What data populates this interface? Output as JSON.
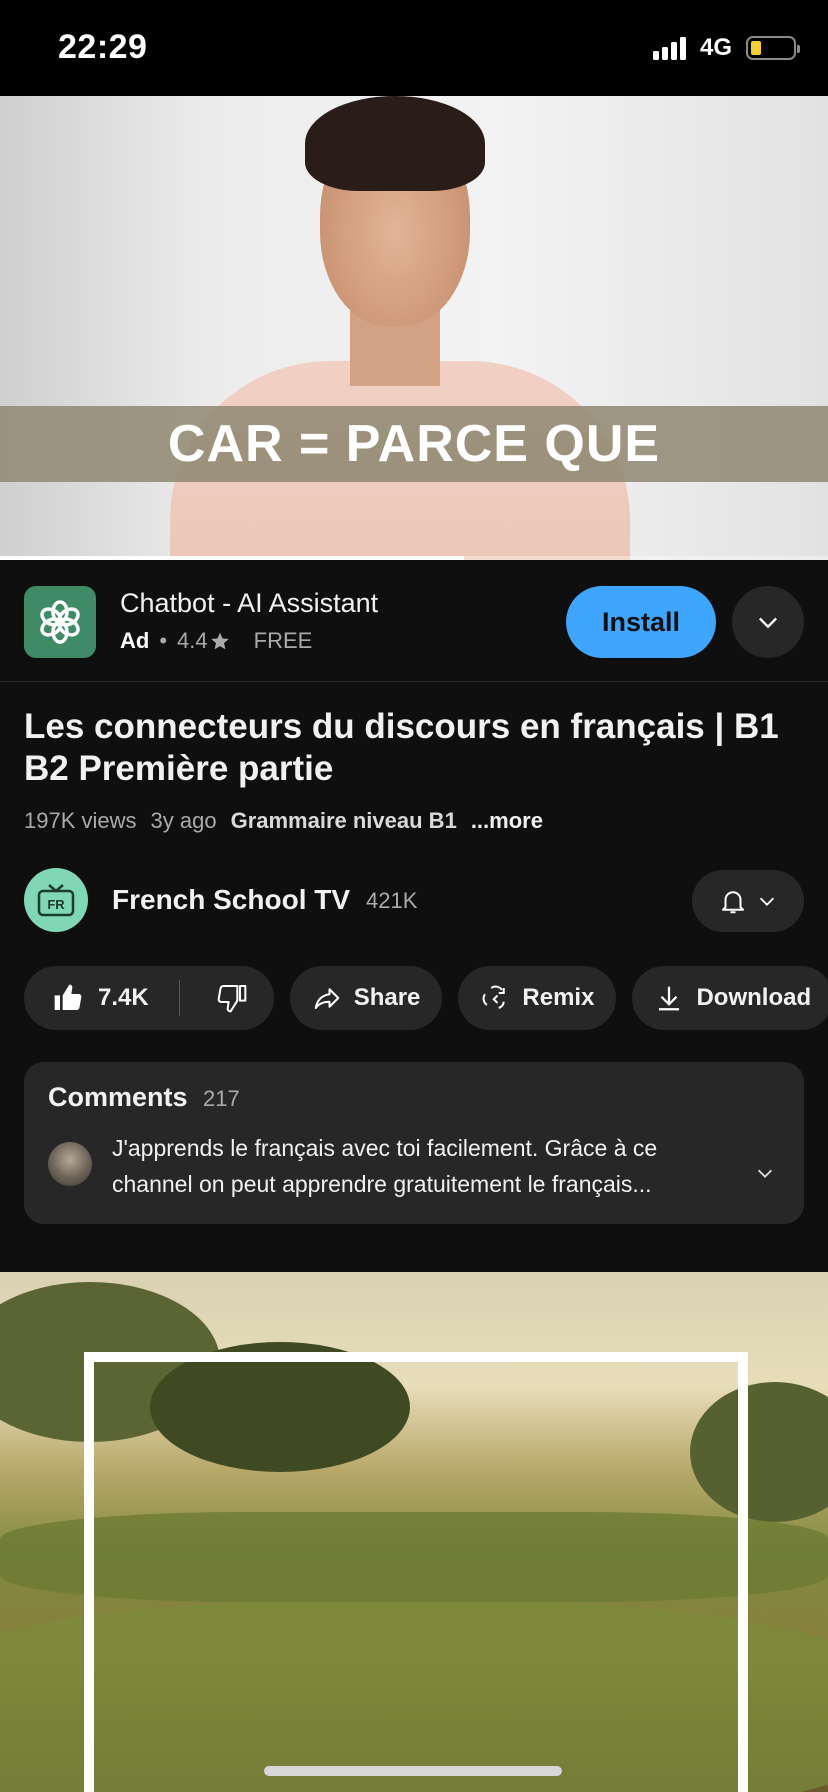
{
  "status_bar": {
    "time": "22:29",
    "network": "4G"
  },
  "video": {
    "caption": "CAR = PARCE QUE",
    "progress_fraction": 0.56
  },
  "ad": {
    "app_name": "Chatbot - AI Assistant",
    "badge": "Ad",
    "separator": "•",
    "rating": "4.4",
    "price": "FREE",
    "install_label": "Install",
    "icon": "chatgpt-flower-icon"
  },
  "video_info": {
    "title": "Les connecteurs du discours en français | B1 B2 Première partie",
    "views": "197K views",
    "age": "3y ago",
    "hashtag": "Grammaire niveau B1",
    "more_label": "...more"
  },
  "channel": {
    "name": "French School TV",
    "subscribers": "421K",
    "avatar_text": "FR"
  },
  "actions": {
    "likes": "7.4K",
    "share": "Share",
    "remix": "Remix",
    "download": "Download"
  },
  "comments": {
    "heading": "Comments",
    "count": "217",
    "top_comment": "J'apprends le français avec toi facilement. Grâce à ce channel on peut apprendre gratuitement le français..."
  },
  "colors": {
    "background": "#0f0f0f",
    "install_button": "#3ea6ff",
    "pill_background": "#272727",
    "ad_icon": "#3f8b66",
    "channel_avatar": "#7fd7b5"
  }
}
